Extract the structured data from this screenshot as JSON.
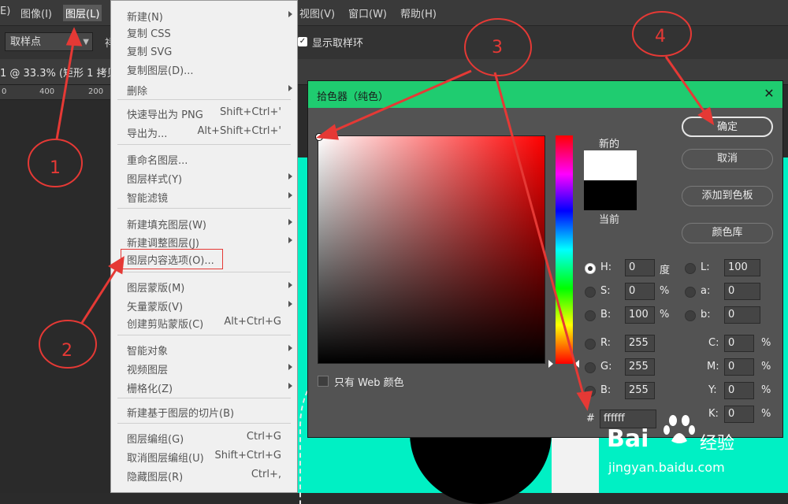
{
  "menubar": {
    "items": [
      "E)",
      "图像(I)",
      "图层(L)",
      "视图(V)",
      "窗口(W)",
      "帮助(H)"
    ]
  },
  "options": {
    "sample": "取样点",
    "sample_right": "祥",
    "ring_label": "显示取样环",
    "check": "✓"
  },
  "document": {
    "title": "1 @ 33.3% (矩形 1 拷贝",
    "ruler": [
      "0",
      "400",
      "200"
    ]
  },
  "menu": {
    "items": [
      {
        "label": "新建(N)",
        "shortcut": ""
      },
      {
        "label": "复制 CSS",
        "shortcut": ""
      },
      {
        "label": "复制 SVG",
        "shortcut": ""
      },
      {
        "label": "复制图层(D)...",
        "shortcut": ""
      },
      {
        "label": "删除",
        "shortcut": ""
      },
      {
        "label": "快速导出为 PNG",
        "shortcut": "Shift+Ctrl+'"
      },
      {
        "label": "导出为...",
        "shortcut": "Alt+Shift+Ctrl+'"
      },
      {
        "label": "重命名图层...",
        "shortcut": ""
      },
      {
        "label": "图层样式(Y)",
        "shortcut": ""
      },
      {
        "label": "智能滤镜",
        "shortcut": ""
      },
      {
        "label": "新建填充图层(W)",
        "shortcut": ""
      },
      {
        "label": "新建调整图层(J)",
        "shortcut": ""
      },
      {
        "label": "图层内容选项(O)...",
        "shortcut": ""
      },
      {
        "label": "图层蒙版(M)",
        "shortcut": ""
      },
      {
        "label": "矢量蒙版(V)",
        "shortcut": ""
      },
      {
        "label": "创建剪贴蒙版(C)",
        "shortcut": "Alt+Ctrl+G"
      },
      {
        "label": "智能对象",
        "shortcut": ""
      },
      {
        "label": "视频图层",
        "shortcut": ""
      },
      {
        "label": "栅格化(Z)",
        "shortcut": ""
      },
      {
        "label": "新建基于图层的切片(B)",
        "shortcut": ""
      },
      {
        "label": "图层编组(G)",
        "shortcut": "Ctrl+G"
      },
      {
        "label": "取消图层编组(U)",
        "shortcut": "Shift+Ctrl+G"
      },
      {
        "label": "隐藏图层(R)",
        "shortcut": "Ctrl+,"
      }
    ]
  },
  "picker": {
    "title": "拾色器（纯色）",
    "close": "✕",
    "new_label": "新的",
    "current_label": "当前",
    "buttons": {
      "ok": "确定",
      "cancel": "取消",
      "add_swatch": "添加到色板",
      "library": "颜色库"
    },
    "fields": {
      "H": {
        "label": "H:",
        "value": "0",
        "unit": "度"
      },
      "S": {
        "label": "S:",
        "value": "0",
        "unit": "%"
      },
      "Bv": {
        "label": "B:",
        "value": "100",
        "unit": "%"
      },
      "R": {
        "label": "R:",
        "value": "255"
      },
      "G": {
        "label": "G:",
        "value": "255"
      },
      "Bc": {
        "label": "B:",
        "value": "255"
      },
      "L": {
        "label": "L:",
        "value": "100"
      },
      "a": {
        "label": "a:",
        "value": "0"
      },
      "b": {
        "label": "b:",
        "value": "0"
      },
      "C": {
        "label": "C:",
        "value": "0",
        "unit": "%"
      },
      "M": {
        "label": "M:",
        "value": "0",
        "unit": "%"
      },
      "Y": {
        "label": "Y:",
        "value": "0",
        "unit": "%"
      },
      "K": {
        "label": "K:",
        "value": "0",
        "unit": "%"
      }
    },
    "hex_label": "#",
    "hex": "ffffff",
    "web_only": "只有 Web 颜色"
  },
  "annotations": [
    "1",
    "2",
    "3",
    "4"
  ],
  "watermark": {
    "bai": "Bai",
    "jingyan": "经验",
    "url": "jingyan.baidu.com"
  },
  "colors": {
    "teal": "#00f0c4",
    "dialog_title": "#1fcc70",
    "annotation": "#e53935"
  }
}
